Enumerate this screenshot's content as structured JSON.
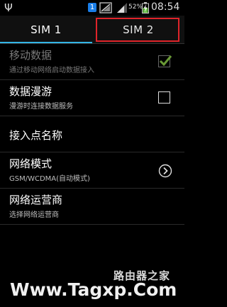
{
  "status_bar": {
    "usb_icon": "usb-icon",
    "sim_number": "1",
    "battery_percent": "52%",
    "time": "08:54"
  },
  "tabs": [
    {
      "label": "SIM 1",
      "selected": true
    },
    {
      "label": "SIM 2",
      "selected": false
    }
  ],
  "settings": {
    "mobile_data": {
      "title": "移动数据",
      "subtitle": "通过移动网络启动数据接入",
      "checked": true,
      "enabled": false
    },
    "data_roaming": {
      "title": "数据漫游",
      "subtitle": "漫游时连接数据服务",
      "checked": false,
      "enabled": true
    },
    "apn": {
      "title": "接入点名称"
    },
    "network_mode": {
      "title": "网络模式",
      "subtitle": "GSM/WCDMA(自动模式)"
    },
    "network_operator": {
      "title": "网络运营商",
      "subtitle": "选择网络运营商"
    }
  },
  "watermark": {
    "site_name": "路由器之家",
    "url": "Www.Tagxp.Com"
  },
  "colors": {
    "accent": "#33b5e5",
    "highlight_box": "#e0242a",
    "sim_badge": "#1a7ee8",
    "checkmark": "#8fd13b"
  }
}
